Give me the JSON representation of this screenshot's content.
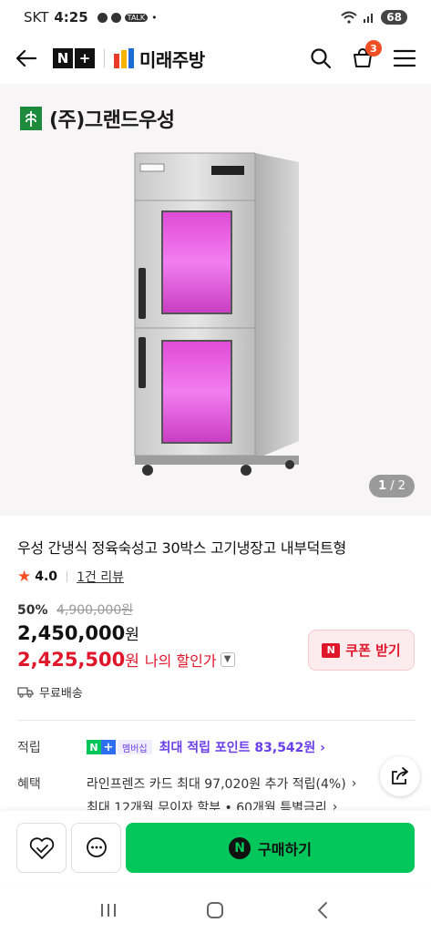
{
  "status_bar": {
    "carrier": "SKT",
    "time": "4:25",
    "talk_badge": "TALK",
    "battery": "68"
  },
  "header": {
    "nplus_n": "N",
    "nplus_plus": "+",
    "shop_name": "미래주방",
    "cart_count": "3"
  },
  "hero": {
    "brand_name": "(주)그랜드우성",
    "pager_current": "1",
    "pager_sep": " / ",
    "pager_total": "2"
  },
  "product": {
    "title": "우성 간냉식 정육숙성고 30박스 고기냉장고 내부덕트형",
    "rating": "4.0",
    "review_link": "1건 리뷰",
    "discount_pct": "50%",
    "original_price": "4,900,000원",
    "price": "2,450,000",
    "price_unit": "원",
    "my_price": "2,425,500",
    "my_price_unit": "원",
    "my_price_label": "나의 할인가",
    "coupon_label": "쿠폰 받기",
    "shipping": "무료배송"
  },
  "benefits": {
    "points_key": "적립",
    "membership_label": "멤버십",
    "points_text": "최대 적립 포인트 83,542원",
    "benefit_key": "혜택",
    "benefit_line1": "라인프렌즈 카드 최대 97,020원 추가 적립(4%)",
    "benefit_line2": "최대 12개월 무이자 할부 • 60개월 특별금리"
  },
  "bottom_bar": {
    "buy_label": "구매하기"
  },
  "colors": {
    "naver_green": "#03c75a",
    "sale_red": "#e0162b",
    "membership_purple": "#6a3ee8",
    "cart_badge": "#f04e23"
  }
}
